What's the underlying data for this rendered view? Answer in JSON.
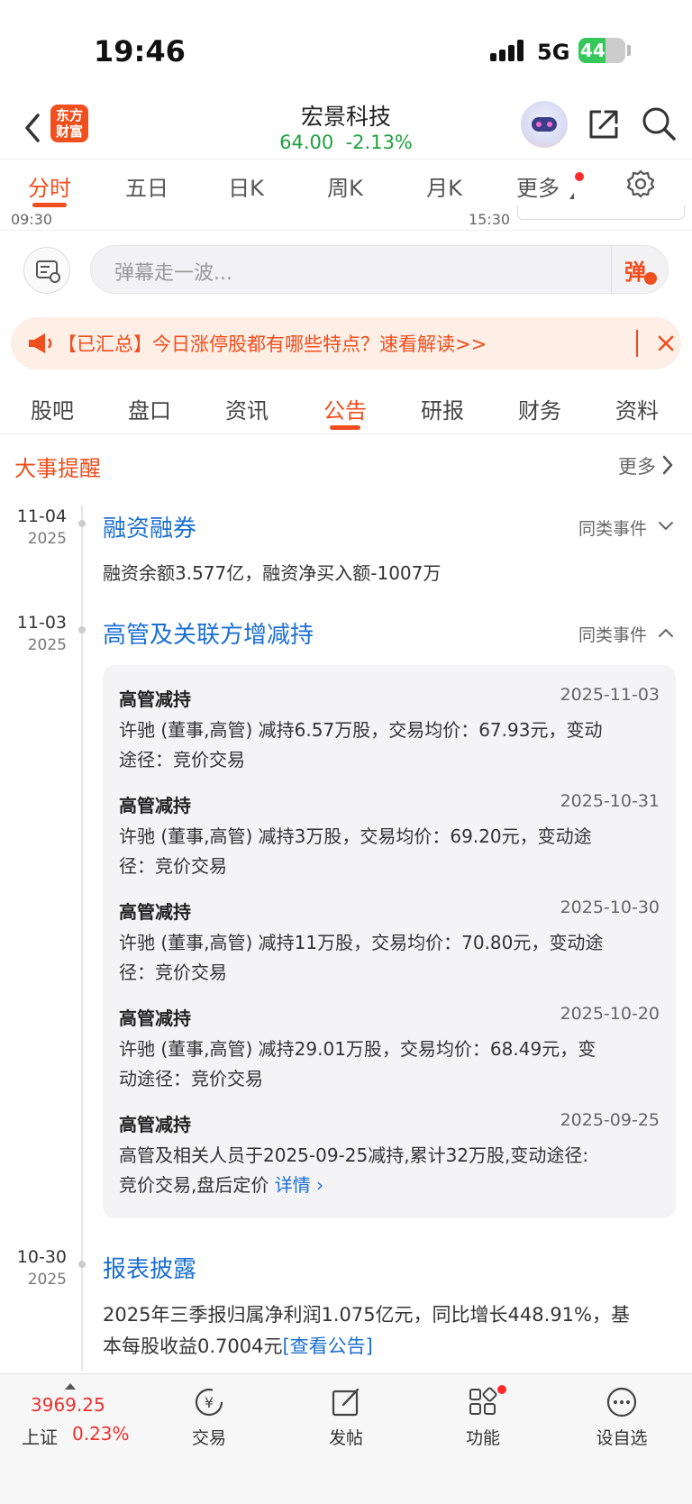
{
  "status_bar": {
    "time": "19:46",
    "network": "5G",
    "battery": "44"
  },
  "header": {
    "logo_line1": "东方",
    "logo_line2": "财富",
    "stock_name": "宏景科技",
    "price": "64.00",
    "change": "-2.13%"
  },
  "kline_tabs": [
    "分时",
    "五日",
    "日K",
    "周K",
    "月K",
    "更多"
  ],
  "timeaxis": {
    "start": "09:30",
    "end": "15:30"
  },
  "danmu": {
    "placeholder": "弹幕走一波...",
    "send": "弹"
  },
  "notice": {
    "text": "【已汇总】今日涨停股都有哪些特点？速看解读>>"
  },
  "info_tabs": [
    "股吧",
    "盘口",
    "资讯",
    "公告",
    "研报",
    "财务",
    "资料"
  ],
  "section": {
    "title": "大事提醒",
    "more": "更多"
  },
  "events": [
    {
      "date": "11-04",
      "year": "2025",
      "title": "融资融券",
      "similar": "同类事件",
      "text": "融资余额3.577亿，融资净买入额-1007万"
    },
    {
      "date": "11-03",
      "year": "2025",
      "title": "高管及关联方增减持",
      "similar": "同类事件",
      "details": [
        {
          "type": "高管减持",
          "date": "2025-11-03",
          "line1": "许驰 (董事,高管) 减持6.57万股，交易均价：67.93元，变动",
          "line2": "途径：竞价交易"
        },
        {
          "type": "高管减持",
          "date": "2025-10-31",
          "line1": "许驰 (董事,高管) 减持3万股，交易均价：69.20元，变动途",
          "line2": "径：竞价交易"
        },
        {
          "type": "高管减持",
          "date": "2025-10-30",
          "line1": "许驰 (董事,高管) 减持11万股，交易均价：70.80元，变动途",
          "line2": "径：竞价交易"
        },
        {
          "type": "高管减持",
          "date": "2025-10-20",
          "line1": "许驰 (董事,高管) 减持29.01万股，交易均价：68.49元，变",
          "line2": "动途径：竞价交易"
        },
        {
          "type": "高管减持",
          "date": "2025-09-25",
          "line1": "高管及相关人员于2025-09-25减持,累计32万股,变动途径:",
          "line2": "竞价交易,盘后定价",
          "link": "详情 ›"
        }
      ]
    },
    {
      "date": "10-30",
      "year": "2025",
      "title": "报表披露",
      "line1": "2025年三季报归属净利润1.075亿元，同比增长448.91%，基",
      "line2": "本每股收益0.7004元",
      "link": "[查看公告]"
    }
  ],
  "bottom_bar": {
    "index_value": "3969.25",
    "index_name": "上证",
    "index_change": "0.23%",
    "items": [
      "交易",
      "发帖",
      "功能",
      "设自选"
    ]
  },
  "colors": {
    "accent": "#f04e1c",
    "up": "#f03030",
    "down": "#20a040",
    "link": "#1b6fd1"
  }
}
